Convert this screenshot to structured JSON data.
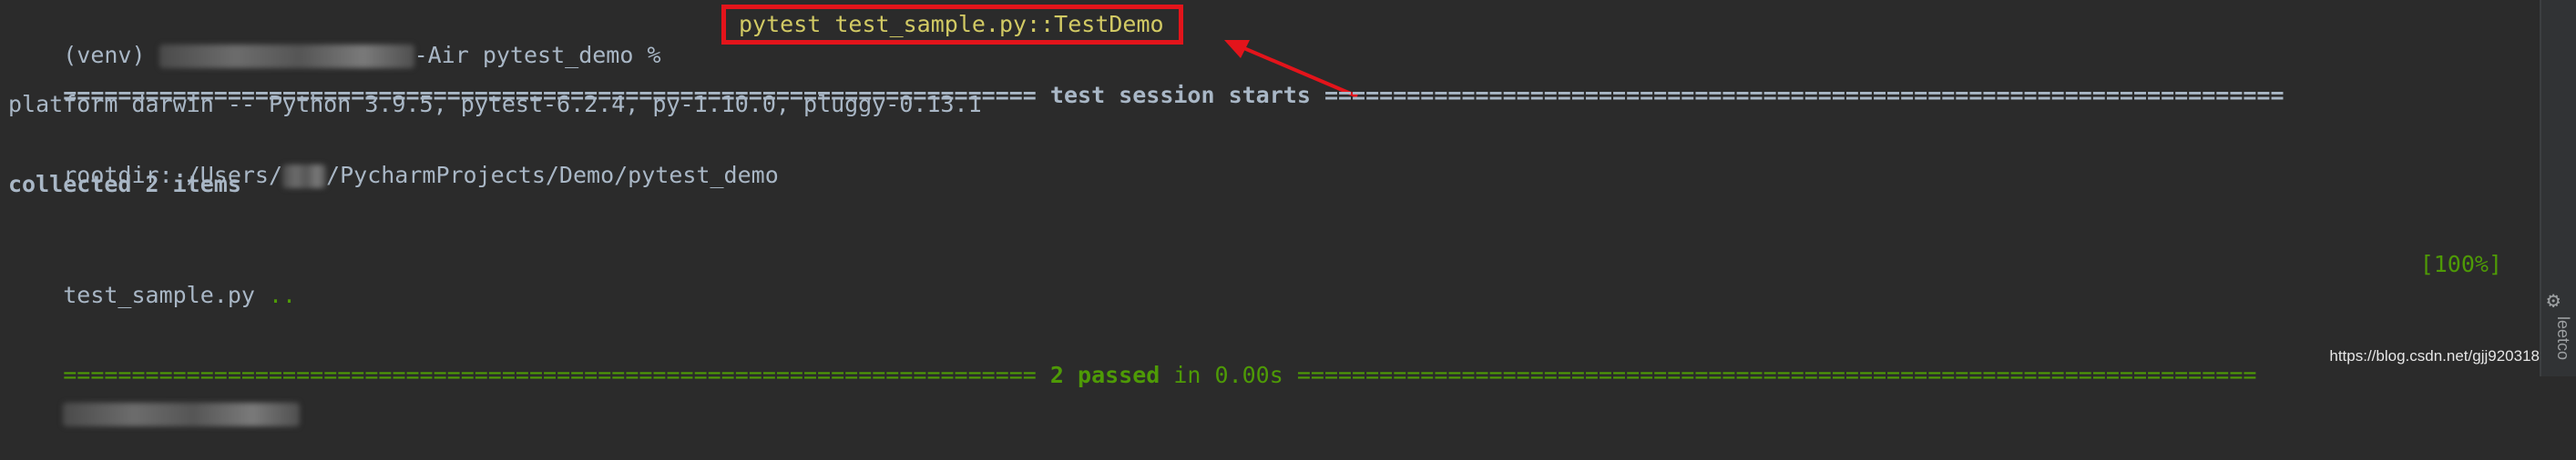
{
  "prompt": {
    "venv": "(venv) ",
    "host_suffix": "-Air pytest_demo % ",
    "command": "pytest test_sample.py::TestDemo"
  },
  "session_header": {
    "left_rule": "=======================================================================",
    "title": " test session starts ",
    "right_rule": "======================================================================"
  },
  "platform_line": "platform darwin -- Python 3.9.5, pytest-6.2.4, py-1.10.0, pluggy-0.13.1",
  "rootdir": {
    "prefix": "rootdir: /Users/",
    "suffix": "/PycharmProjects/Demo/pytest_demo"
  },
  "collected": "collected 2 items",
  "result_line": {
    "file": "test_sample.py ",
    "dots": "..",
    "percent": "[100%]"
  },
  "summary": {
    "left_rule": "=======================================================================",
    "passed": " 2 passed",
    "time": " in 0.00s ",
    "right_rule": "======================================================================"
  },
  "gutter": {
    "icon": "settings-gear-icon",
    "label": "leetco"
  },
  "watermark": "https://blog.csdn.net/gjj920318",
  "colors": {
    "background": "#2b2b2b",
    "text": "#a9b7c6",
    "command": "#d2ca64",
    "pass_green": "#4e9a06",
    "highlight_red": "#e3141b"
  }
}
